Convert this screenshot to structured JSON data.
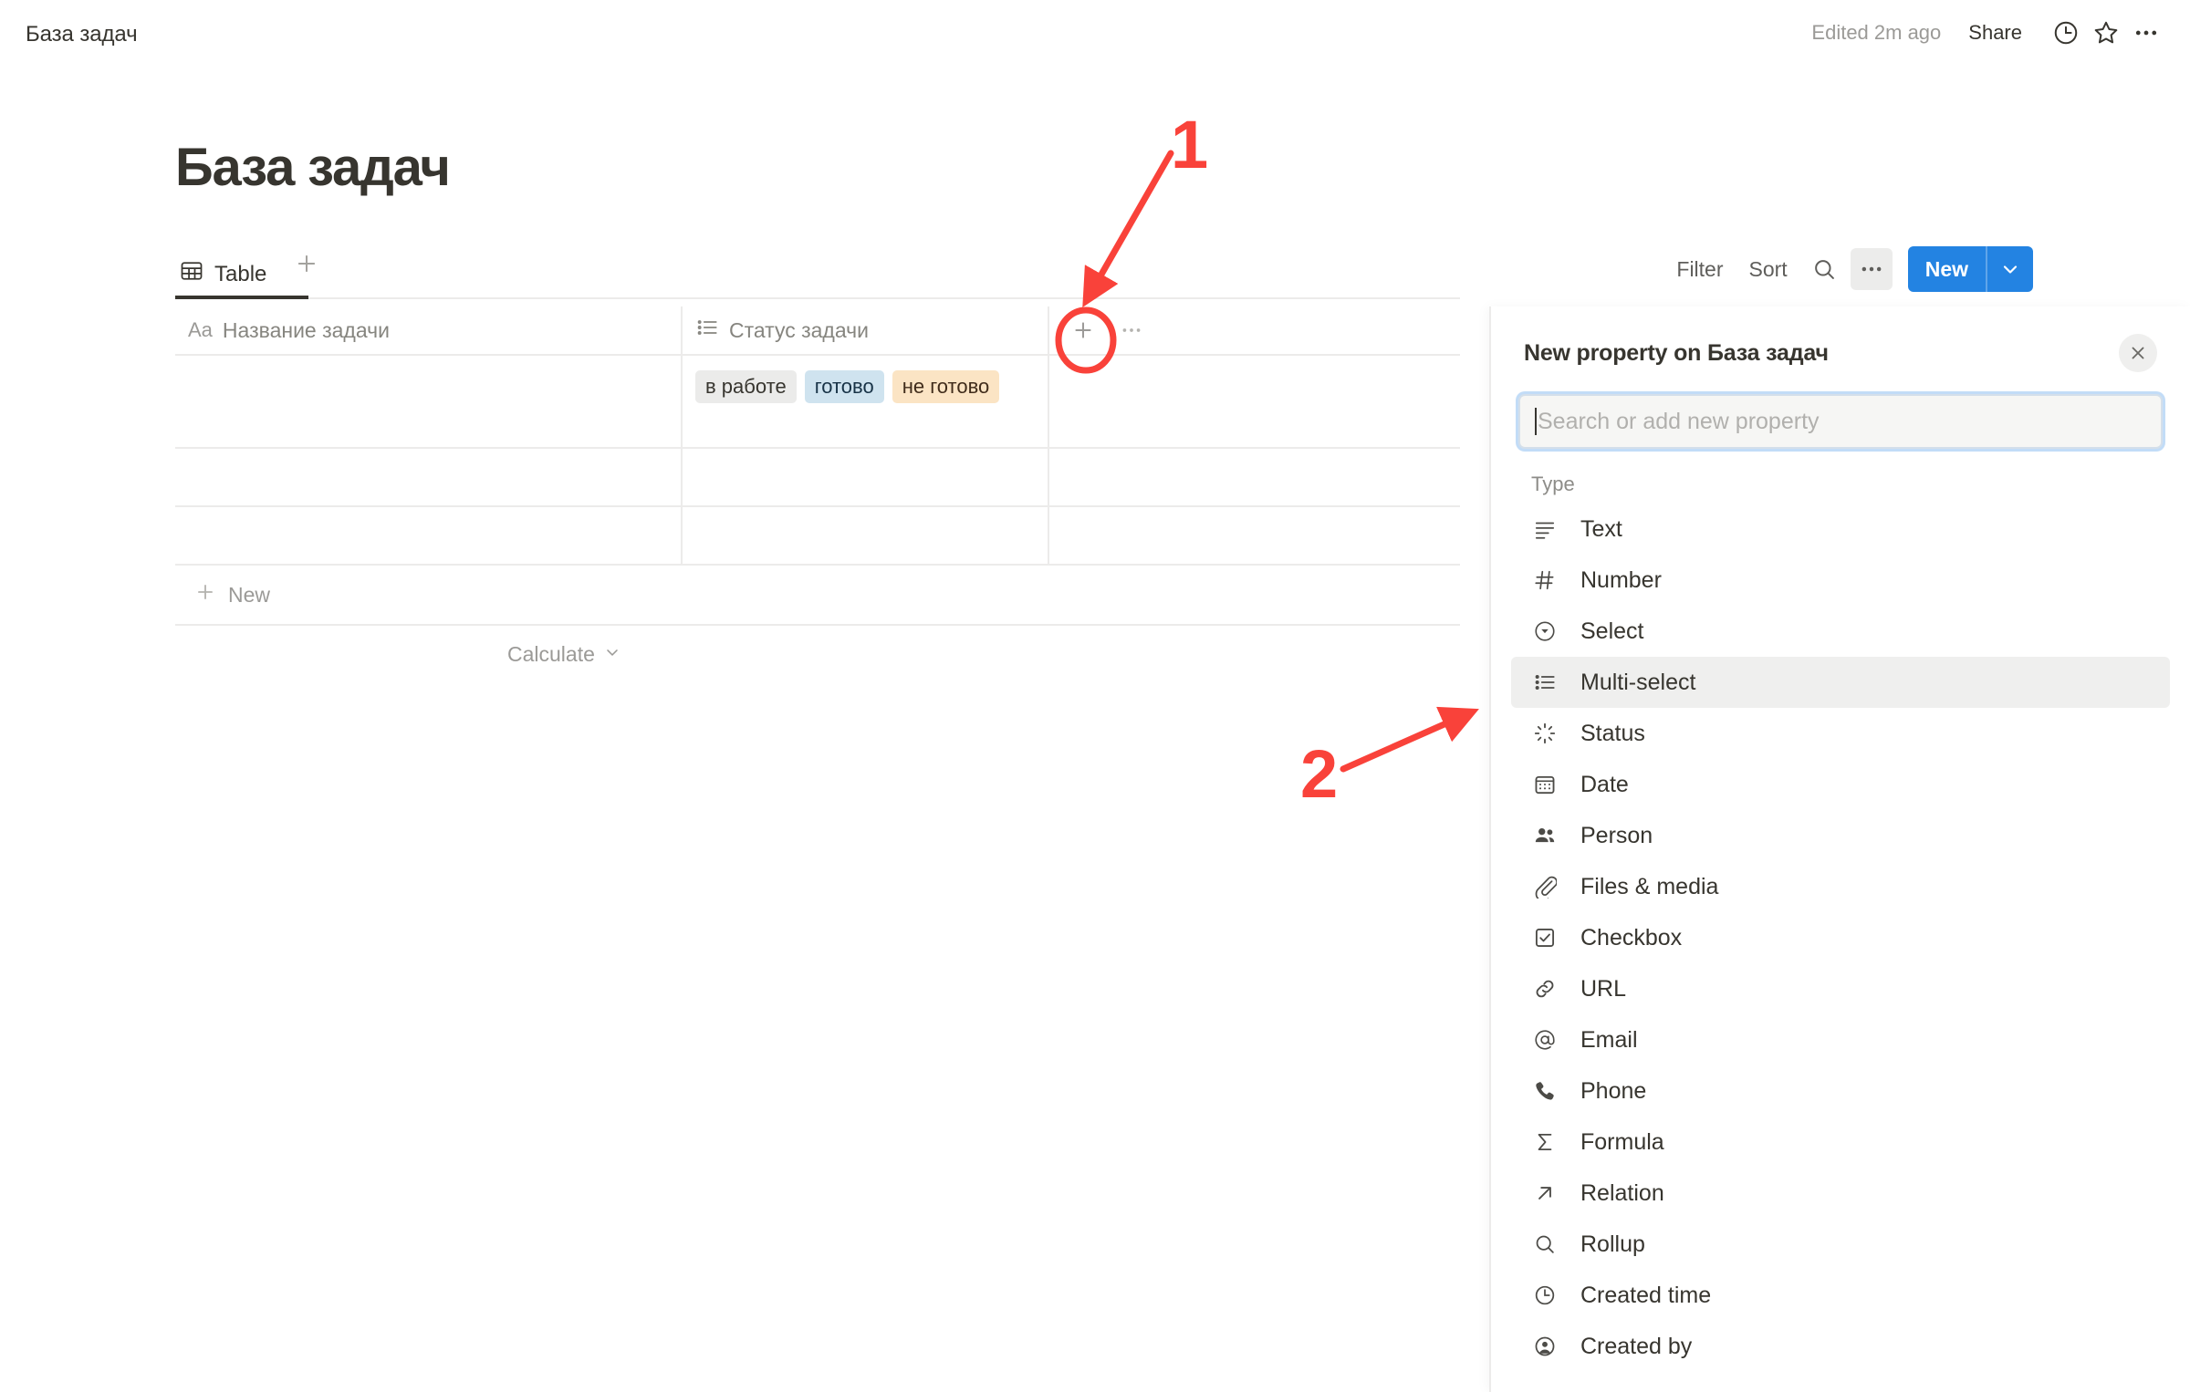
{
  "topbar": {
    "breadcrumb": "База задач",
    "edited_label": "Edited 2m ago",
    "share_label": "Share",
    "icons": {
      "history": "clock-icon",
      "favorite": "star-icon",
      "more": "ellipsis-icon"
    }
  },
  "page": {
    "title": "База задач"
  },
  "viewbar": {
    "tabs": [
      {
        "label": "Table",
        "icon": "table-icon",
        "active": true
      }
    ],
    "add_view_icon": "plus-icon"
  },
  "toolbar": {
    "filter_label": "Filter",
    "sort_label": "Sort",
    "search_icon": "search-icon",
    "more_icon": "ellipsis-icon",
    "new_label": "New",
    "new_caret_icon": "chevron-down-icon",
    "new_button_color": "#2383e2"
  },
  "table": {
    "columns": [
      {
        "label": "Название задачи",
        "icon": "Aa",
        "type": "title"
      },
      {
        "label": "Статус задачи",
        "icon": "multiselect-icon",
        "type": "multi-select"
      }
    ],
    "add_column_icon": "plus-icon",
    "column_more_icon": "ellipsis-icon",
    "rows": [
      {
        "name": "",
        "tags": [
          {
            "label": "в работе",
            "bg": "#ebebea",
            "fg": "#37352f"
          },
          {
            "label": "готово",
            "bg": "#cfe3ef",
            "fg": "#183347"
          },
          {
            "label": "не готово",
            "bg": "#fbe4c4",
            "fg": "#402c1b"
          }
        ]
      },
      {
        "name": "",
        "tags": []
      },
      {
        "name": "",
        "tags": []
      }
    ],
    "new_row_label": "New",
    "new_row_icon": "plus-icon",
    "calculate_label": "Calculate",
    "calculate_caret_icon": "chevron-down-icon"
  },
  "panel": {
    "title": "New property on База задач",
    "close_icon": "close-icon",
    "search_placeholder": "Search or add new property",
    "search_value": "",
    "section_label": "Type",
    "types": [
      {
        "label": "Text",
        "icon": "text-icon",
        "hover": false
      },
      {
        "label": "Number",
        "icon": "hash-icon",
        "hover": false
      },
      {
        "label": "Select",
        "icon": "select-icon",
        "hover": false
      },
      {
        "label": "Multi-select",
        "icon": "multiselect-icon",
        "hover": true
      },
      {
        "label": "Status",
        "icon": "status-icon",
        "hover": false
      },
      {
        "label": "Date",
        "icon": "calendar-icon",
        "hover": false
      },
      {
        "label": "Person",
        "icon": "person-icon",
        "hover": false
      },
      {
        "label": "Files & media",
        "icon": "paperclip-icon",
        "hover": false
      },
      {
        "label": "Checkbox",
        "icon": "checkbox-icon",
        "hover": false
      },
      {
        "label": "URL",
        "icon": "link-icon",
        "hover": false
      },
      {
        "label": "Email",
        "icon": "at-icon",
        "hover": false
      },
      {
        "label": "Phone",
        "icon": "phone-icon",
        "hover": false
      },
      {
        "label": "Formula",
        "icon": "sigma-icon",
        "hover": false
      },
      {
        "label": "Relation",
        "icon": "arrow-up-right-icon",
        "hover": false
      },
      {
        "label": "Rollup",
        "icon": "search-icon",
        "hover": false
      },
      {
        "label": "Created time",
        "icon": "clock-icon",
        "hover": false
      },
      {
        "label": "Created by",
        "icon": "user-circle-icon",
        "hover": false
      }
    ]
  },
  "annotations": {
    "color": "#f9423a",
    "markers": [
      {
        "number": "1",
        "target": "add-column-plus-button"
      },
      {
        "number": "2",
        "target": "type-item-multi-select"
      }
    ]
  }
}
